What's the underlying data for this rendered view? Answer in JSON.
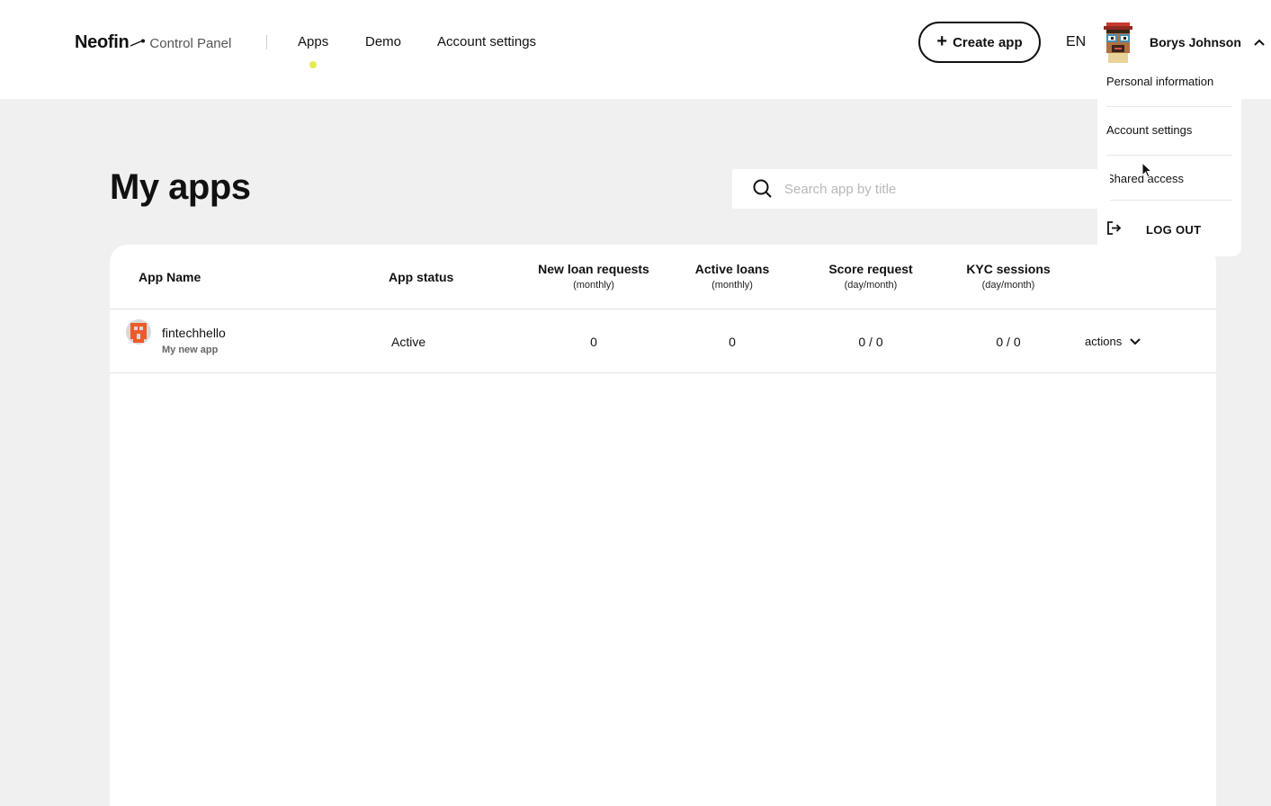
{
  "header": {
    "logo_word": "Neofin",
    "logo_sub": "Control Panel",
    "nav": [
      {
        "label": "Apps",
        "active": true
      },
      {
        "label": "Demo",
        "active": false
      },
      {
        "label": "Account settings",
        "active": false
      }
    ],
    "create_label": "Create app",
    "language": "EN",
    "user_name": "Borys Johnson"
  },
  "user_menu": {
    "items": [
      "Personal information",
      "Account settings",
      "Shared access"
    ],
    "logout_label": "LOG OUT"
  },
  "main": {
    "title": "My apps",
    "search_placeholder": "Search app by title"
  },
  "table": {
    "columns": [
      {
        "label": "App Name",
        "sub": ""
      },
      {
        "label": "App status",
        "sub": ""
      },
      {
        "label": "New loan requests",
        "sub": "(monthly)"
      },
      {
        "label": "Active loans",
        "sub": "(monthly)"
      },
      {
        "label": "Score request",
        "sub": "(day/month)"
      },
      {
        "label": "KYC sessions",
        "sub": "(day/month)"
      }
    ],
    "rows": [
      {
        "name": "fintechhello",
        "description": "My new app",
        "status": "Active",
        "new_loan_requests": "0",
        "active_loans": "0",
        "score_request": "0 / 0",
        "kyc_sessions": "0 / 0",
        "actions_label": "actions"
      }
    ]
  },
  "colors": {
    "accent_dot": "#e3ec4e",
    "app_icon": "#f05a28",
    "page_bg": "#f0f0f0"
  }
}
